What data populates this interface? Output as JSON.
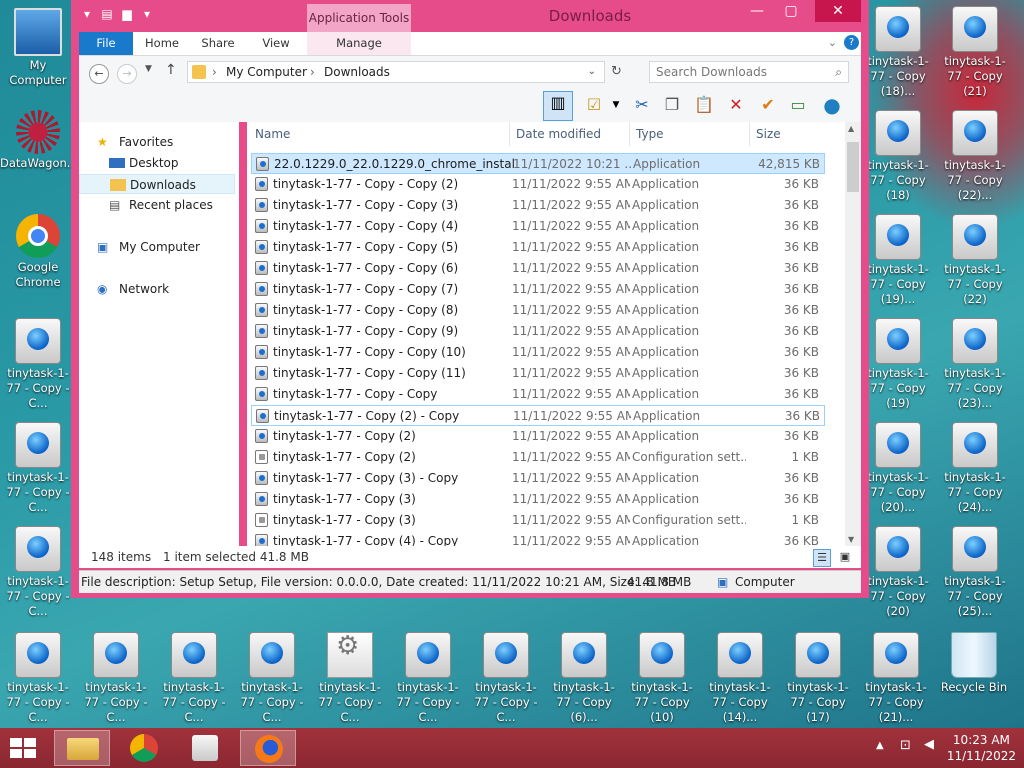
{
  "window": {
    "title": "Downloads",
    "context_tab": "Application Tools",
    "controls": {
      "minimize": "—",
      "maximize": "▢",
      "close": "✕"
    }
  },
  "ribbon": {
    "tabs": [
      {
        "label": "File"
      },
      {
        "label": "Home"
      },
      {
        "label": "Share"
      },
      {
        "label": "View"
      },
      {
        "label": "Manage"
      }
    ]
  },
  "address": {
    "path": [
      "My Computer",
      "Downloads"
    ],
    "search_placeholder": "Search Downloads"
  },
  "nav_pane": {
    "favorites": "Favorites",
    "desktop": "Desktop",
    "downloads": "Downloads",
    "recent": "Recent places",
    "my_computer": "My Computer",
    "network": "Network"
  },
  "columns": {
    "name": "Name",
    "date": "Date modified",
    "type": "Type",
    "size": "Size"
  },
  "files": [
    {
      "name": "22.0.1229.0_22.0.1229.0_chrome_installer",
      "date": "11/11/2022 10:21 ...",
      "type": "Application",
      "size": "42,815 KB",
      "icon": "installer",
      "selected": true
    },
    {
      "name": "tinytask-1-77 - Copy - Copy (2)",
      "date": "11/11/2022 9:55 AM",
      "type": "Application",
      "size": "36 KB",
      "icon": "app"
    },
    {
      "name": "tinytask-1-77 - Copy - Copy (3)",
      "date": "11/11/2022 9:55 AM",
      "type": "Application",
      "size": "36 KB",
      "icon": "app"
    },
    {
      "name": "tinytask-1-77 - Copy - Copy (4)",
      "date": "11/11/2022 9:55 AM",
      "type": "Application",
      "size": "36 KB",
      "icon": "app"
    },
    {
      "name": "tinytask-1-77 - Copy - Copy (5)",
      "date": "11/11/2022 9:55 AM",
      "type": "Application",
      "size": "36 KB",
      "icon": "app"
    },
    {
      "name": "tinytask-1-77 - Copy - Copy (6)",
      "date": "11/11/2022 9:55 AM",
      "type": "Application",
      "size": "36 KB",
      "icon": "app"
    },
    {
      "name": "tinytask-1-77 - Copy - Copy (7)",
      "date": "11/11/2022 9:55 AM",
      "type": "Application",
      "size": "36 KB",
      "icon": "app"
    },
    {
      "name": "tinytask-1-77 - Copy - Copy (8)",
      "date": "11/11/2022 9:55 AM",
      "type": "Application",
      "size": "36 KB",
      "icon": "app"
    },
    {
      "name": "tinytask-1-77 - Copy - Copy (9)",
      "date": "11/11/2022 9:55 AM",
      "type": "Application",
      "size": "36 KB",
      "icon": "app"
    },
    {
      "name": "tinytask-1-77 - Copy - Copy (10)",
      "date": "11/11/2022 9:55 AM",
      "type": "Application",
      "size": "36 KB",
      "icon": "app"
    },
    {
      "name": "tinytask-1-77 - Copy - Copy (11)",
      "date": "11/11/2022 9:55 AM",
      "type": "Application",
      "size": "36 KB",
      "icon": "app"
    },
    {
      "name": "tinytask-1-77 - Copy - Copy",
      "date": "11/11/2022 9:55 AM",
      "type": "Application",
      "size": "36 KB",
      "icon": "app"
    },
    {
      "name": "tinytask-1-77 - Copy (2) - Copy",
      "date": "11/11/2022 9:55 AM",
      "type": "Application",
      "size": "36 KB",
      "icon": "app",
      "focus": true
    },
    {
      "name": "tinytask-1-77 - Copy (2)",
      "date": "11/11/2022 9:55 AM",
      "type": "Application",
      "size": "36 KB",
      "icon": "app"
    },
    {
      "name": "tinytask-1-77 - Copy (2)",
      "date": "11/11/2022 9:55 AM",
      "type": "Configuration sett...",
      "size": "1 KB",
      "icon": "cfg"
    },
    {
      "name": "tinytask-1-77 - Copy (3) - Copy",
      "date": "11/11/2022 9:55 AM",
      "type": "Application",
      "size": "36 KB",
      "icon": "app"
    },
    {
      "name": "tinytask-1-77 - Copy (3)",
      "date": "11/11/2022 9:55 AM",
      "type": "Application",
      "size": "36 KB",
      "icon": "app"
    },
    {
      "name": "tinytask-1-77 - Copy (3)",
      "date": "11/11/2022 9:55 AM",
      "type": "Configuration sett...",
      "size": "1 KB",
      "icon": "cfg"
    },
    {
      "name": "tinytask-1-77 - Copy (4) - Copy",
      "date": "11/11/2022 9:55 AM",
      "type": "Application",
      "size": "36 KB",
      "icon": "app"
    }
  ],
  "status": {
    "items": "148 items",
    "selected": "1 item selected  41.8 MB",
    "description": "File description: Setup Setup, File version: 0.0.0.0, Date created: 11/11/2022 10:21 AM, Size: 41.8 MB",
    "size": "41.8 MB",
    "location": "Computer"
  },
  "desktop": {
    "left_icons": [
      {
        "label": "My Computer",
        "kind": "pc"
      },
      {
        "label": "DataWagon...",
        "kind": "dw"
      },
      {
        "label": "Google Chrome",
        "kind": "chrome"
      },
      {
        "label": "tinytask-1-77 - Copy - C...",
        "kind": "tt"
      },
      {
        "label": "tinytask-1-77 - Copy - C...",
        "kind": "tt"
      },
      {
        "label": "tinytask-1-77 - Copy - C...",
        "kind": "tt"
      }
    ],
    "right_col1": [
      {
        "label": "tinytask-1-77 - Copy (18)...",
        "kind": "tt"
      },
      {
        "label": "tinytask-1-77 - Copy (18)",
        "kind": "tt"
      },
      {
        "label": "tinytask-1-77 - Copy (19)...",
        "kind": "tt"
      },
      {
        "label": "tinytask-1-77 - Copy (19)",
        "kind": "tt"
      },
      {
        "label": "tinytask-1-77 - Copy (20)...",
        "kind": "tt"
      },
      {
        "label": "tinytask-1-77 - Copy (20)",
        "kind": "tt"
      }
    ],
    "right_col2": [
      {
        "label": "tinytask-1-77 - Copy (21)",
        "kind": "tt"
      },
      {
        "label": "tinytask-1-77 - Copy (22)...",
        "kind": "tt"
      },
      {
        "label": "tinytask-1-77 - Copy (22)",
        "kind": "tt"
      },
      {
        "label": "tinytask-1-77 - Copy (23)...",
        "kind": "tt"
      },
      {
        "label": "tinytask-1-77 - Copy (24)...",
        "kind": "tt"
      },
      {
        "label": "tinytask-1-77 - Copy (25)...",
        "kind": "tt"
      }
    ],
    "bottom_row": [
      {
        "label": "tinytask-1-77 - Copy - C...",
        "kind": "tt"
      },
      {
        "label": "tinytask-1-77 - Copy - C...",
        "kind": "tt"
      },
      {
        "label": "tinytask-1-77 - Copy - C...",
        "kind": "tt"
      },
      {
        "label": "tinytask-1-77 - Copy - C...",
        "kind": "tt"
      },
      {
        "label": "tinytask-1-77 - Copy - C...",
        "kind": "cfg"
      },
      {
        "label": "tinytask-1-77 - Copy - C...",
        "kind": "tt"
      },
      {
        "label": "tinytask-1-77 - Copy - C...",
        "kind": "tt"
      },
      {
        "label": "tinytask-1-77 - Copy (6)...",
        "kind": "tt"
      },
      {
        "label": "tinytask-1-77 - Copy (10)",
        "kind": "tt"
      },
      {
        "label": "tinytask-1-77 - Copy (14)...",
        "kind": "tt"
      },
      {
        "label": "tinytask-1-77 - Copy (17)",
        "kind": "tt"
      },
      {
        "label": "tinytask-1-77 - Copy (21)...",
        "kind": "tt"
      },
      {
        "label": "Recycle Bin",
        "kind": "bin"
      }
    ]
  },
  "taskbar": {
    "time": "10:23 AM",
    "date": "11/11/2022"
  }
}
